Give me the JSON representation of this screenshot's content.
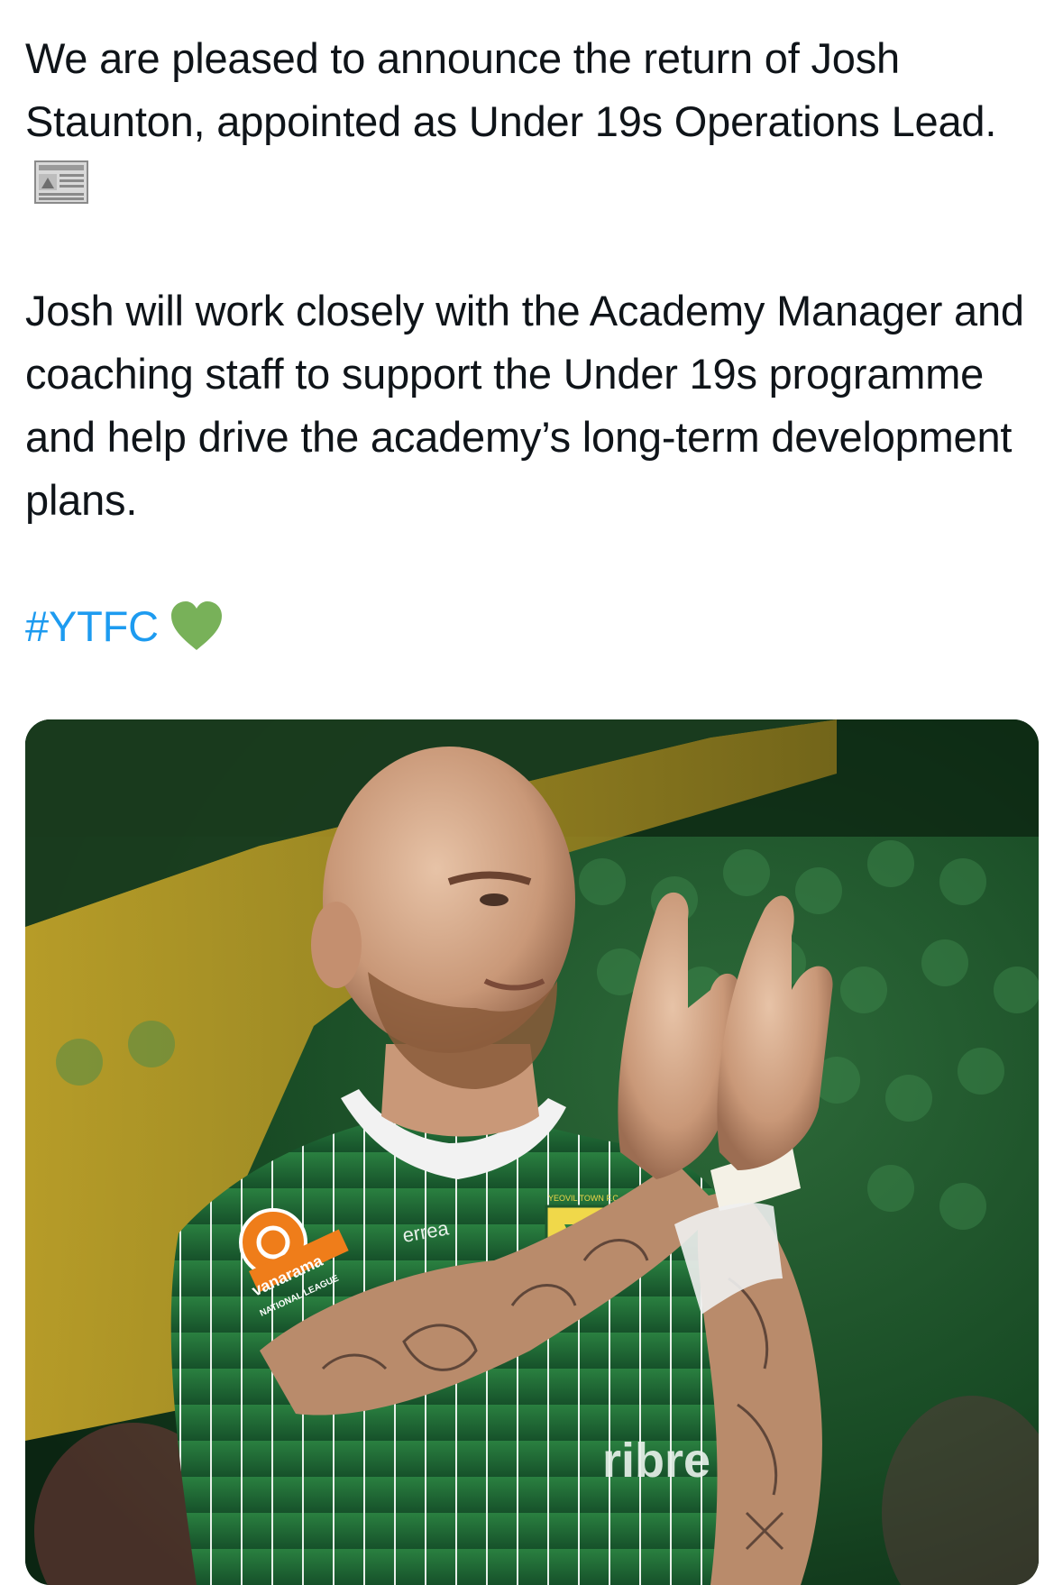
{
  "tweet": {
    "paragraph1": "We are pleased to announce the return of Josh Staunton, appointed as Under 19s Operations Lead.",
    "paragraph2": "Josh will work closely with the Academy Manager and coaching staff to support the Under 19s programme and help drive the academy’s long-term development plans.",
    "hashtag": "#YTFC",
    "emoji_after_paragraph1": "newspaper-icon",
    "emoji_after_hashtag": "green-heart-icon"
  },
  "media": {
    "kit_sponsor_left": "vanarama",
    "kit_sponsor_left_sub": "NATIONAL LEAGUE",
    "kit_maker": "errea",
    "club_crest_text": "YEOVIL TOWN F.C.",
    "shirt_sponsor_partial": "ribre"
  },
  "colors": {
    "hashtag": "#1d9bf0",
    "text": "#0f1419",
    "kit_green": "#1f6b34",
    "heart_green": "#78b159"
  }
}
